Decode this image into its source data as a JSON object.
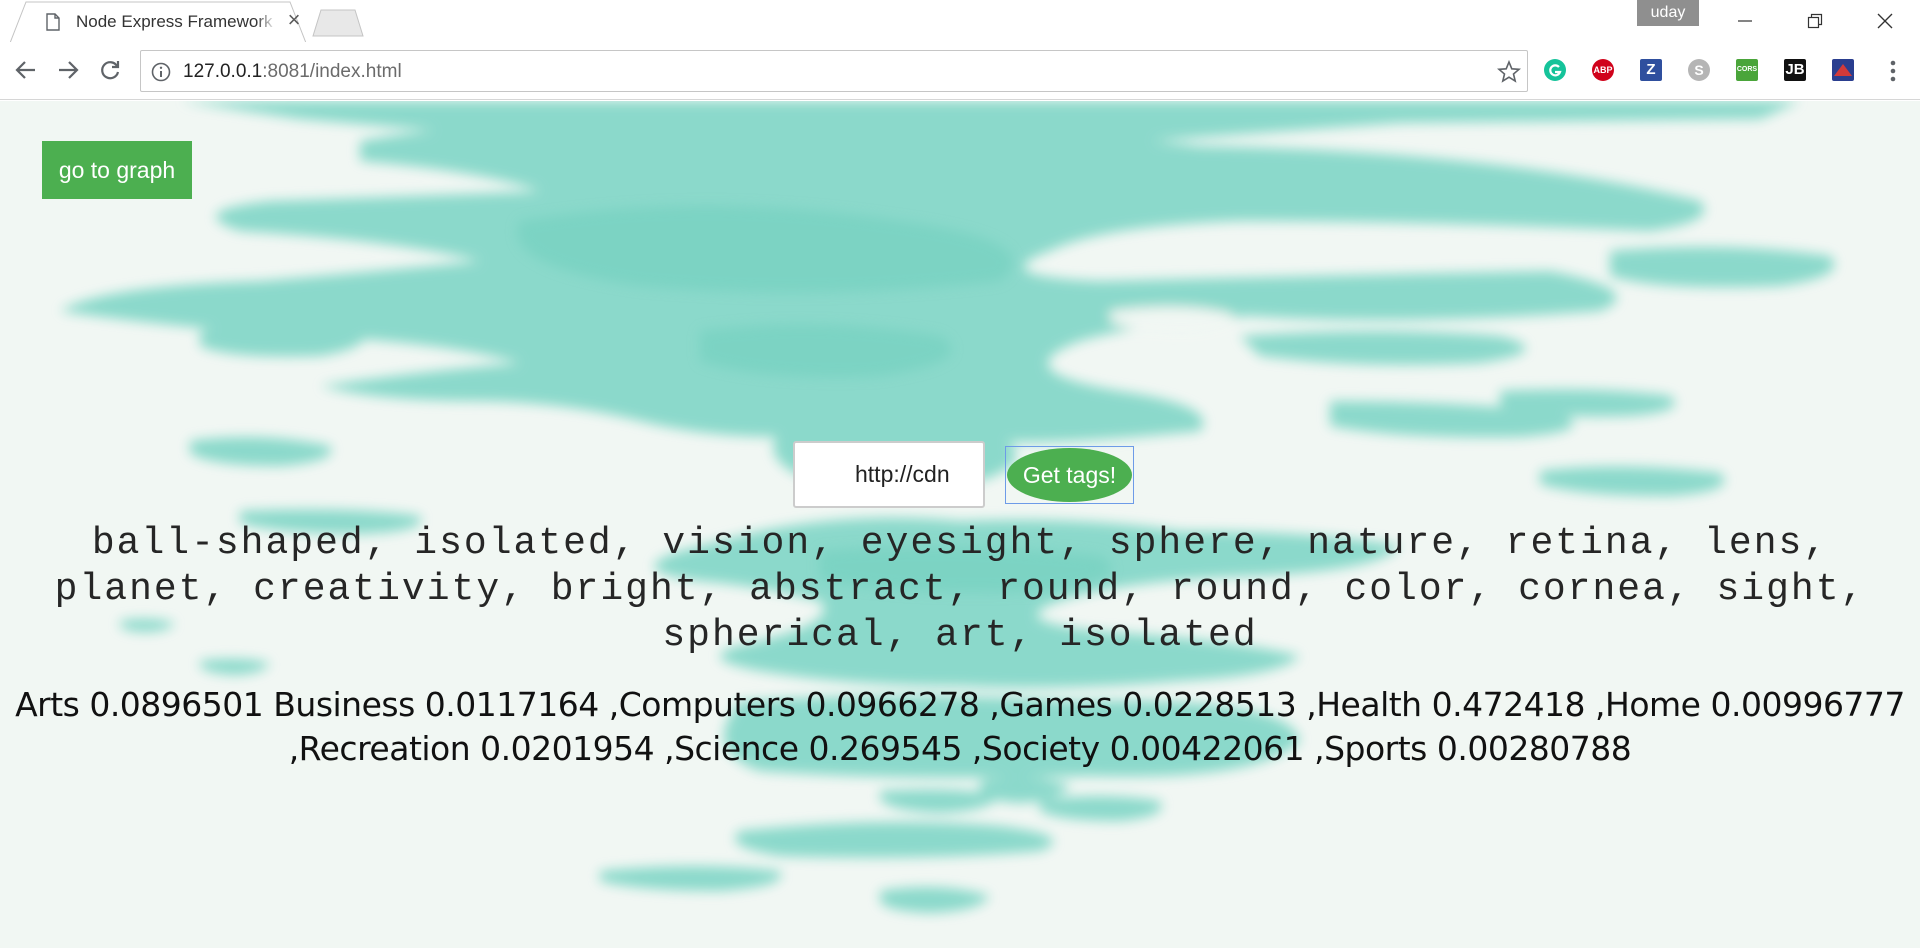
{
  "browser": {
    "tab_title": "Node Express Framework",
    "user_name": "uday",
    "url_host": "127.0.0.1",
    "url_rest": ":8081/index.html",
    "extensions": [
      {
        "name": "grammarly-icon",
        "label": "",
        "color": "#15c39a"
      },
      {
        "name": "adblock-plus-icon",
        "label": "ABP",
        "color": "#d0021b"
      },
      {
        "name": "zotero-icon",
        "label": "Z",
        "color": "#2f4f9e"
      },
      {
        "name": "skype-icon",
        "label": "",
        "color": "#b5b5b5"
      },
      {
        "name": "cors-icon",
        "label": "CORS",
        "color": "#4aa53a"
      },
      {
        "name": "jetbrains-icon",
        "label": "JB",
        "color": "#111111"
      },
      {
        "name": "extension-icon",
        "label": "",
        "color": "#2a3e8f"
      }
    ]
  },
  "page": {
    "graph_button": "go to graph",
    "url_input_value": "http://cdn",
    "get_tags_button": "Get tags!",
    "tags": "ball-shaped, isolated, vision, eyesight, sphere, nature, retina, lens, planet, creativity, bright, abstract, round, round, color, cornea, sight, spherical, art, isolated",
    "categories": "Arts 0.0896501 Business 0.0117164 ,Computers 0.0966278 ,Games 0.0228513 ,Health 0.472418 ,Home 0.00996777 ,Recreation 0.0201954 ,Science 0.269545 ,Society 0.00422061 ,Sports 0.00280788",
    "accent_color": "#4caf50",
    "watercolor_color": "#7fd6c6"
  }
}
